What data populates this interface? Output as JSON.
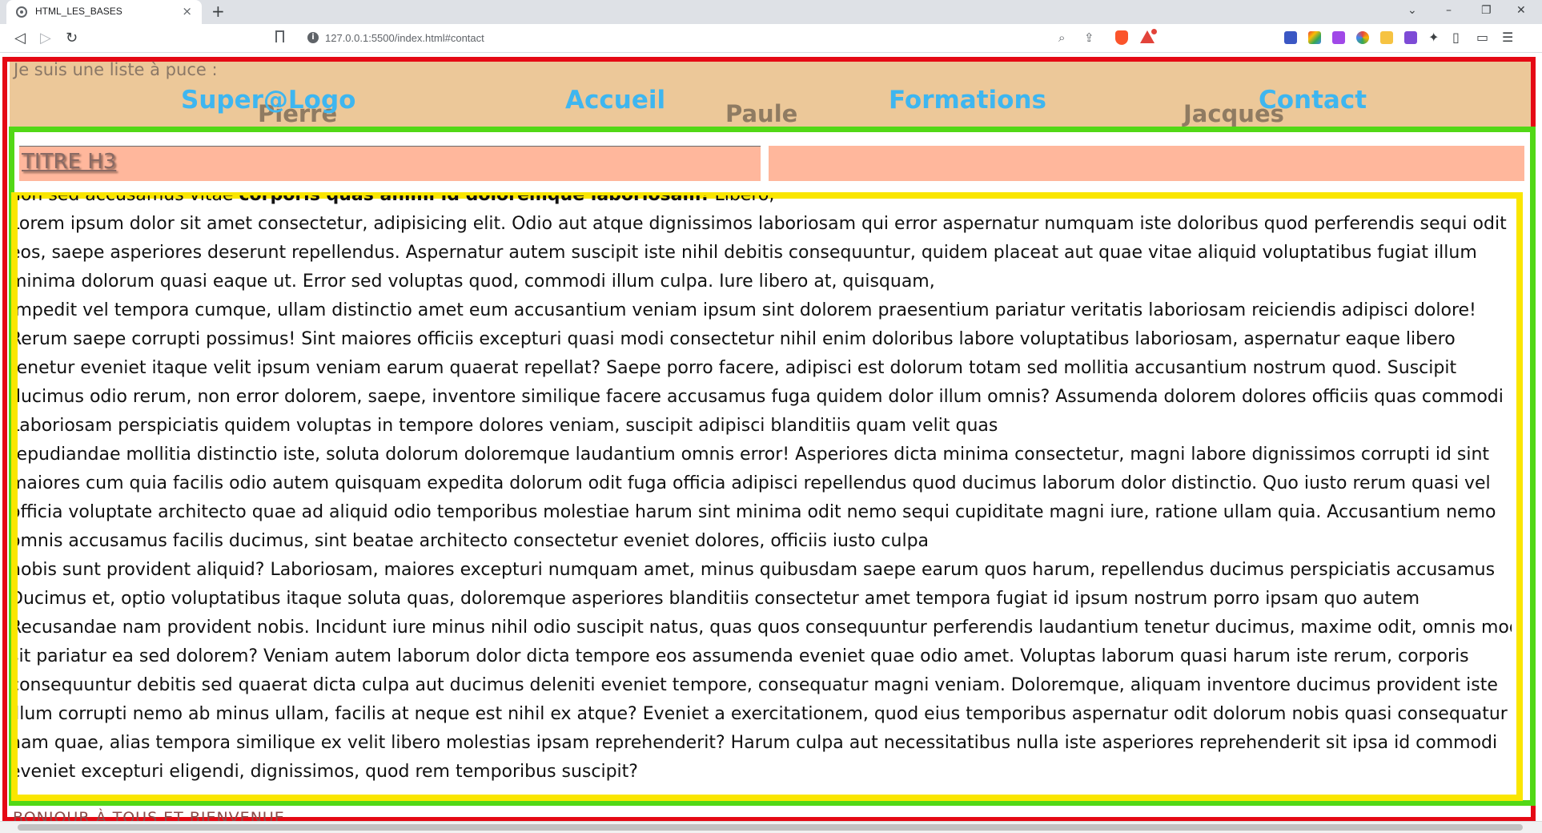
{
  "browser": {
    "tab_title": "HTML_LES_BASES",
    "tab_close": "×",
    "new_tab": "+",
    "url": "127.0.0.1:5500/index.html#contact",
    "nav": {
      "back": "◁",
      "forward": "▷",
      "reload": "↻"
    },
    "window": {
      "dropdown": "⌄",
      "minimize": "–",
      "restore": "❐",
      "close": "✕"
    }
  },
  "header": {
    "list_label": "Je suis une liste à puce :",
    "people": [
      "Pierre",
      "Paule",
      "Jacques"
    ],
    "nav": [
      "Super@Logo",
      "Accueil",
      "Formations",
      "Contact"
    ]
  },
  "section": {
    "h3": "TITRE H3",
    "paragraph_lines": [
      "non sed accusamus vitae ",
      "Lorem ipsum dolor sit amet consectetur, adipisicing elit. Odio aut atque dignissimos laboriosam qui error aspernatur numquam iste doloribus quod perferendis sequi odit",
      "eos, saepe asperiores deserunt repellendus. Aspernatur autem suscipit iste nihil debitis consequuntur, quidem placeat aut quae vitae aliquid voluptatibus fugiat illum",
      "minima dolorum quasi eaque ut. Error sed voluptas quod, commodi illum culpa. Iure libero at, quisquam,",
      "Impedit vel tempora cumque, ullam distinctio amet eum accusantium veniam ipsum sint dolorem praesentium pariatur veritatis laboriosam reiciendis adipisci dolore!",
      "Rerum saepe corrupti possimus! Sint maiores officiis excepturi quasi modi consectetur nihil enim doloribus labore voluptatibus laboriosam, aspernatur eaque libero",
      "tenetur eveniet itaque velit ipsum veniam earum quaerat repellat? Saepe porro facere, adipisci est dolorum totam sed mollitia accusantium nostrum quod. Suscipit",
      "ducimus odio rerum, non error dolorem, saepe, inventore similique facere accusamus fuga quidem dolor illum omnis? Assumenda dolorem dolores officiis quas commodi",
      "Laboriosam perspiciatis quidem voluptas in tempore dolores veniam, suscipit adipisci blanditiis quam velit quas",
      "repudiandae mollitia distinctio iste, soluta dolorum doloremque laudantium omnis error! Asperiores dicta minima consectetur, magni labore dignissimos corrupti id sint",
      "maiores cum quia facilis odio autem quisquam expedita dolorum odit fuga officia adipisci repellendus quod ducimus laborum dolor distinctio. Quo iusto rerum quasi vel",
      "officia voluptate architecto quae ad aliquid odio temporibus molestiae harum sint minima odit nemo sequi cupiditate magni iure, ratione ullam quia. Accusantium nemo",
      "omnis accusamus facilis ducimus, sint beatae architecto consectetur eveniet dolores, officiis iusto culpa",
      "nobis sunt provident aliquid? Laboriosam, maiores excepturi numquam amet, minus quibusdam saepe earum quos harum, repellendus ducimus perspiciatis accusamus",
      "Ducimus et, optio voluptatibus itaque soluta quas, doloremque asperiores blanditiis consectetur amet tempora fugiat id ipsum nostrum porro ipsam quo autem",
      "Recusandae nam provident nobis. Incidunt iure minus nihil odio suscipit natus, quas quos consequuntur perferendis laudantium tenetur ducimus, maxime odit, omnis modi",
      "sit pariatur ea sed dolorem? Veniam autem laborum dolor dicta tempore eos assumenda eveniet quae odio amet. Voluptas laborum quasi harum iste rerum, corporis",
      "consequuntur debitis sed quaerat dicta culpa aut ducimus deleniti eveniet tempore, consequatur magni veniam. Doloremque, aliquam inventore ducimus provident iste",
      "illum corrupti nemo ab minus ullam, facilis at neque est nihil ex atque? Eveniet a exercitationem, quod eius temporibus aspernatur odit dolorum nobis quasi consequatur",
      "nam quae, alias tempora similique ex velit libero molestias ipsam reprehenderit? Harum culpa aut necessitatibus nulla iste asperiores reprehenderit sit ipsa id commodi",
      "eveniet excepturi eligendi, dignissimos, quod rem temporibus suscipit?"
    ],
    "bold_fragment": "corporis quas animi id doloremque laboriosam!",
    "line0_tail": " Libero,"
  },
  "footer": {
    "text": "BONJOUR À TOUS ET BIENVENUE"
  },
  "colors": {
    "header_border": "#e50914",
    "main_border": "#52d816",
    "text_border": "#fae600",
    "header_bg": "#ecc899",
    "nav_link": "#3eb6f0",
    "h3_bg": "#ffb79c"
  }
}
